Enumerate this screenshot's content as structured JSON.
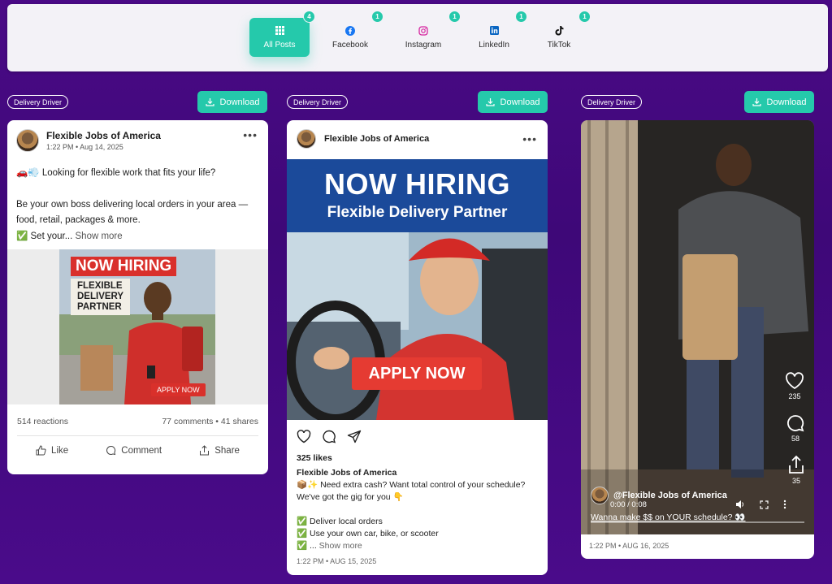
{
  "tabs": [
    {
      "label": "All Posts",
      "icon": "grid-icon",
      "count": "4",
      "active": true
    },
    {
      "label": "Facebook",
      "icon": "facebook-icon",
      "count": "1"
    },
    {
      "label": "Instagram",
      "icon": "instagram-icon",
      "count": "1"
    },
    {
      "label": "LinkedIn",
      "icon": "linkedin-icon",
      "count": "1"
    },
    {
      "label": "TikTok",
      "icon": "tiktok-icon",
      "count": "1"
    }
  ],
  "columns": [
    {
      "tag": "Delivery Driver",
      "download": "Download"
    },
    {
      "tag": "Delivery Driver",
      "download": "Download"
    },
    {
      "tag": "Delivery Driver",
      "download": "Download"
    }
  ],
  "facebook": {
    "author": "Flexible Jobs of America",
    "time": "1:22 PM • Aug 14, 2025",
    "line1": "🚗💨 Looking for flexible work that fits your life?",
    "line2": "Be your own boss delivering local orders in your area — food, retail, packages & more.",
    "line3": "✅ Set your...",
    "show_more": "Show more",
    "ad": {
      "hiring": "NOW HIRING",
      "role1": "FLEXIBLE",
      "role2": "DELIVERY",
      "role3": "PARTNER",
      "cta": "APPLY NOW"
    },
    "reactions": "514 reactions",
    "comments_shares": "77 comments • 41 shares",
    "like": "Like",
    "comment": "Comment",
    "share": "Share"
  },
  "instagram": {
    "author": "Flexible Jobs of America",
    "ad": {
      "hiring": "NOW HIRING",
      "subtitle": "Flexible Delivery Partner",
      "cta": "APPLY NOW"
    },
    "likes": "325 likes",
    "caption_author": "Flexible Jobs of America",
    "caption1": "📦✨ Need extra cash? Want total control of your schedule? We've got the gig for you 👇",
    "bullet1": "✅ Deliver local orders",
    "bullet2": "✅ Use your own car, bike, or scooter",
    "bullet3": "✅ ...",
    "show_more": "Show more",
    "date": "1:22 PM • AUG 15, 2025"
  },
  "tiktok": {
    "likes": "235",
    "comments": "58",
    "shares": "35",
    "handle": "@Flexible Jobs of America",
    "time": "0:00 / 0:08",
    "caption": "Wanna make $$ on YOUR schedule? 👀",
    "date": "1:22 PM • AUG 16, 2025"
  },
  "colors": {
    "accent": "#25c9ab",
    "background": "#430a80",
    "ig_banner": "#1b4a9a",
    "cta_red": "#e53b32"
  }
}
